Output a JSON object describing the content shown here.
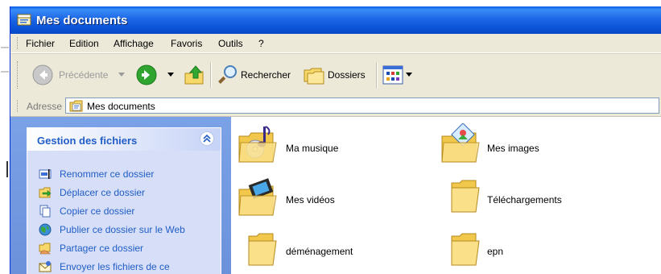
{
  "window": {
    "title": "Mes documents",
    "title_icon": "folder-window-icon",
    "titlebar_color": "#0a52d6"
  },
  "menu": {
    "items": [
      "Fichier",
      "Edition",
      "Affichage",
      "Favoris",
      "Outils",
      "?"
    ]
  },
  "toolbar": {
    "back_label": "Précédente",
    "search_label": "Rechercher",
    "folders_label": "Dossiers"
  },
  "address": {
    "label": "Adresse",
    "value": "Mes documents"
  },
  "sidebar": {
    "panel_title": "Gestion des fichiers",
    "tasks": [
      {
        "label": "Renommer ce dossier",
        "icon": "rename-icon"
      },
      {
        "label": "Déplacer ce dossier",
        "icon": "move-folder-icon"
      },
      {
        "label": "Copier ce dossier",
        "icon": "copy-icon"
      },
      {
        "label": "Publier ce dossier sur le Web",
        "icon": "globe-icon"
      },
      {
        "label": "Partager ce dossier",
        "icon": "share-icon"
      },
      {
        "label": "Envoyer les fichiers de ce dossier par courrier",
        "icon": "email-icon"
      }
    ]
  },
  "files": [
    {
      "name": "Ma musique",
      "icon": "music-folder-icon"
    },
    {
      "name": "Mes images",
      "icon": "pictures-folder-icon"
    },
    {
      "name": "Mes vidéos",
      "icon": "videos-folder-icon"
    },
    {
      "name": "Téléchargements",
      "icon": "folder-icon"
    },
    {
      "name": "déménagement",
      "icon": "folder-icon"
    },
    {
      "name": "epn",
      "icon": "folder-icon"
    }
  ],
  "colors": {
    "sidebar_link": "#215dc6",
    "sidebar_bg": "#6b91db",
    "panel_bg": "#d6dff7",
    "chrome": "#ece9d8"
  }
}
